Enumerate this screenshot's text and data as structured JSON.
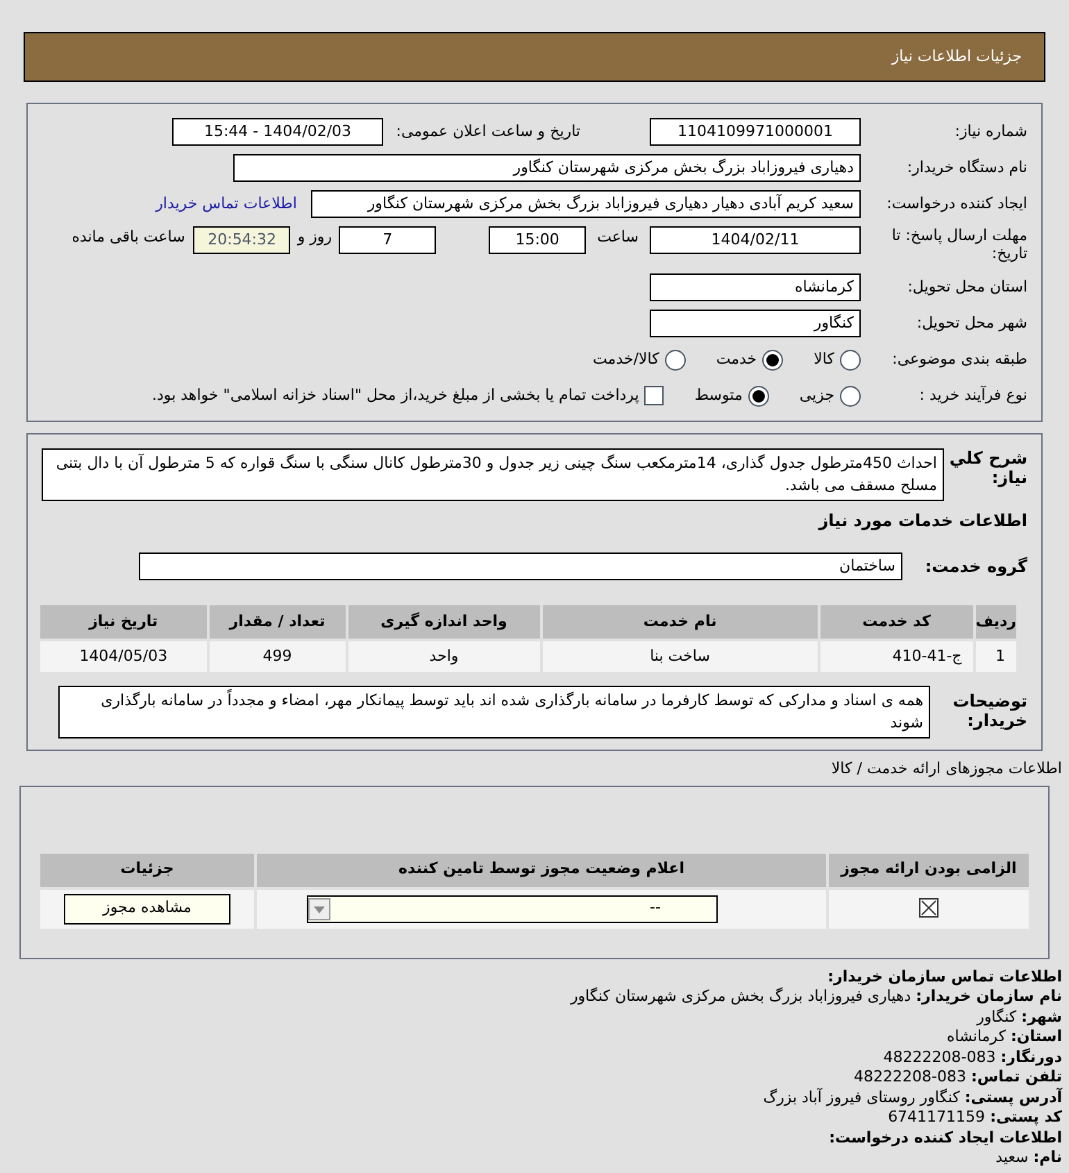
{
  "header": {
    "title": "جزئیات اطلاعات نیاز"
  },
  "need_number": {
    "label": "شماره نیاز:",
    "value": "1104109971000001"
  },
  "announce": {
    "label": "تاریخ و ساعت اعلان عمومی:",
    "value": "1404/02/03 - 15:44"
  },
  "buyer": {
    "label": "نام دستگاه خریدار:",
    "value": "دهیاری فیروزاباد بزرگ بخش مرکزی شهرستان کنگاور"
  },
  "requester": {
    "label": "ایجاد کننده درخواست:",
    "value": "سعید کریم آبادی دهیار دهیاری فیروزاباد بزرگ بخش مرکزی شهرستان کنگاور",
    "link": "اطلاعات تماس خریدار"
  },
  "deadline": {
    "label": "مهلت ارسال پاسخ: تا تاریخ:",
    "date": "1404/02/11",
    "time_label": "ساعت",
    "time": "15:00",
    "days": "7",
    "days_label": "روز و",
    "remaining": "20:54:32",
    "remaining_label": "ساعت باقی مانده"
  },
  "province": {
    "label": "استان محل تحویل:",
    "value": "کرمانشاه"
  },
  "city": {
    "label": "شهر محل تحویل:",
    "value": "کنگاور"
  },
  "category": {
    "label": "طبقه بندی موضوعی:",
    "options": [
      {
        "label": "کالا",
        "selected": false
      },
      {
        "label": "خدمت",
        "selected": true
      },
      {
        "label": "کالا/خدمت",
        "selected": false
      }
    ]
  },
  "process": {
    "label": "نوع فرآیند خرید :",
    "options": [
      {
        "label": "جزیی",
        "selected": false
      },
      {
        "label": "متوسط",
        "selected": true
      }
    ],
    "payment": {
      "label": "پرداخت تمام یا بخشی از مبلغ خرید،از محل \"اسناد خزانه اسلامی\" خواهد بود.",
      "checked": false
    }
  },
  "description": {
    "label": "شرح کلي نیاز:",
    "value": "احداث 450مترطول جدول گذاری، 14مترمکعب سنگ چینی زیر جدول و 30مترطول کانال سنگی با سنگ قواره که 5 مترطول آن با دال بتنی مسلح مسقف می باشد."
  },
  "services_title": "اطلاعات خدمات مورد نیاز",
  "service_group": {
    "label": "گروه خدمت:",
    "value": "ساختمان"
  },
  "table": {
    "columns": [
      "ردیف",
      "کد خدمت",
      "نام خدمت",
      "واحد اندازه گیری",
      "تعداد / مقدار",
      "تاریخ نیاز"
    ],
    "rows": [
      [
        "1",
        "ج-41-410",
        "ساخت بنا",
        "واحد",
        "499",
        "1404/05/03"
      ]
    ]
  },
  "buyer_notes": {
    "label": "توضیحات خریدار:",
    "value": "همه ی اسناد و مدارکی که توسط کارفرما در سامانه بارگذاری شده اند باید توسط پیمانکار مهر، امضاء و مجدداً در سامانه بارگذاری شوند"
  },
  "licenses": {
    "title": "اطلاعات مجوزهای ارائه خدمت / کالا",
    "columns": [
      "الزامی بودن ارائه مجوز",
      "اعلام وضعیت مجوز توسط تامین کننده",
      "جزئیات"
    ],
    "rows": [
      {
        "required": true,
        "status": "--",
        "action": "مشاهده مجوز"
      }
    ]
  },
  "contact": {
    "title": "اطلاعات تماس سازمان خریدار:",
    "items": [
      {
        "label": "نام سازمان خریدار:",
        "value": "دهیاری فیروزاباد بزرگ بخش مرکزی شهرستان کنگاور"
      },
      {
        "label": "شهر:",
        "value": "کنگاور"
      },
      {
        "label": "استان:",
        "value": "کرمانشاه"
      },
      {
        "label": "دورنگار:",
        "value": "083-48222208"
      },
      {
        "label": "تلفن تماس:",
        "value": "083-48222208"
      },
      {
        "label": "آدرس پستی:",
        "value": "کنگاور روستای فیروز آباد بزرگ"
      },
      {
        "label": "کد پستی:",
        "value": "6741171159"
      }
    ]
  },
  "creator": {
    "title": "اطلاعات ایجاد کننده درخواست:",
    "items": [
      {
        "label": "نام:",
        "value": "سعید"
      }
    ]
  }
}
